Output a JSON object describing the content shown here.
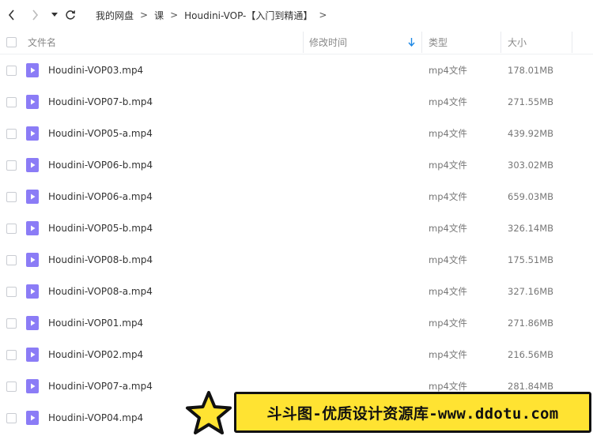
{
  "nav": {
    "back_icon": "chevron-left-icon",
    "forward_icon": "chevron-right-icon",
    "dropdown_icon": "caret-down-icon",
    "refresh_icon": "refresh-icon"
  },
  "breadcrumb": {
    "items": [
      "我的网盘",
      "课",
      "Houdini-VOP-【入门到精通】"
    ],
    "separator": ">"
  },
  "header": {
    "name": "文件名",
    "modified": "修改时间",
    "type": "类型",
    "size": "大小",
    "sort_icon": "sort-down-arrow-icon"
  },
  "files": [
    {
      "name": "Houdini-VOP03.mp4",
      "type": "mp4文件",
      "size": "178.01MB"
    },
    {
      "name": "Houdini-VOP07-b.mp4",
      "type": "mp4文件",
      "size": "271.55MB"
    },
    {
      "name": "Houdini-VOP05-a.mp4",
      "type": "mp4文件",
      "size": "439.92MB"
    },
    {
      "name": "Houdini-VOP06-b.mp4",
      "type": "mp4文件",
      "size": "303.02MB"
    },
    {
      "name": "Houdini-VOP06-a.mp4",
      "type": "mp4文件",
      "size": "659.03MB"
    },
    {
      "name": "Houdini-VOP05-b.mp4",
      "type": "mp4文件",
      "size": "326.14MB"
    },
    {
      "name": "Houdini-VOP08-b.mp4",
      "type": "mp4文件",
      "size": "175.51MB"
    },
    {
      "name": "Houdini-VOP08-a.mp4",
      "type": "mp4文件",
      "size": "327.16MB"
    },
    {
      "name": "Houdini-VOP01.mp4",
      "type": "mp4文件",
      "size": "271.86MB"
    },
    {
      "name": "Houdini-VOP02.mp4",
      "type": "mp4文件",
      "size": "216.56MB"
    },
    {
      "name": "Houdini-VOP07-a.mp4",
      "type": "mp4文件",
      "size": "281.84MB"
    },
    {
      "name": "Houdini-VOP04.mp4",
      "type": "",
      "size": ""
    }
  ],
  "watermark": {
    "text": "斗斗图-优质设计资源库-www.ddotu.com",
    "icon": "star-icon"
  },
  "colors": {
    "file_icon": "#8b7cf6",
    "sort_arrow": "#1e88e5",
    "watermark_bg": "#ffe332"
  }
}
